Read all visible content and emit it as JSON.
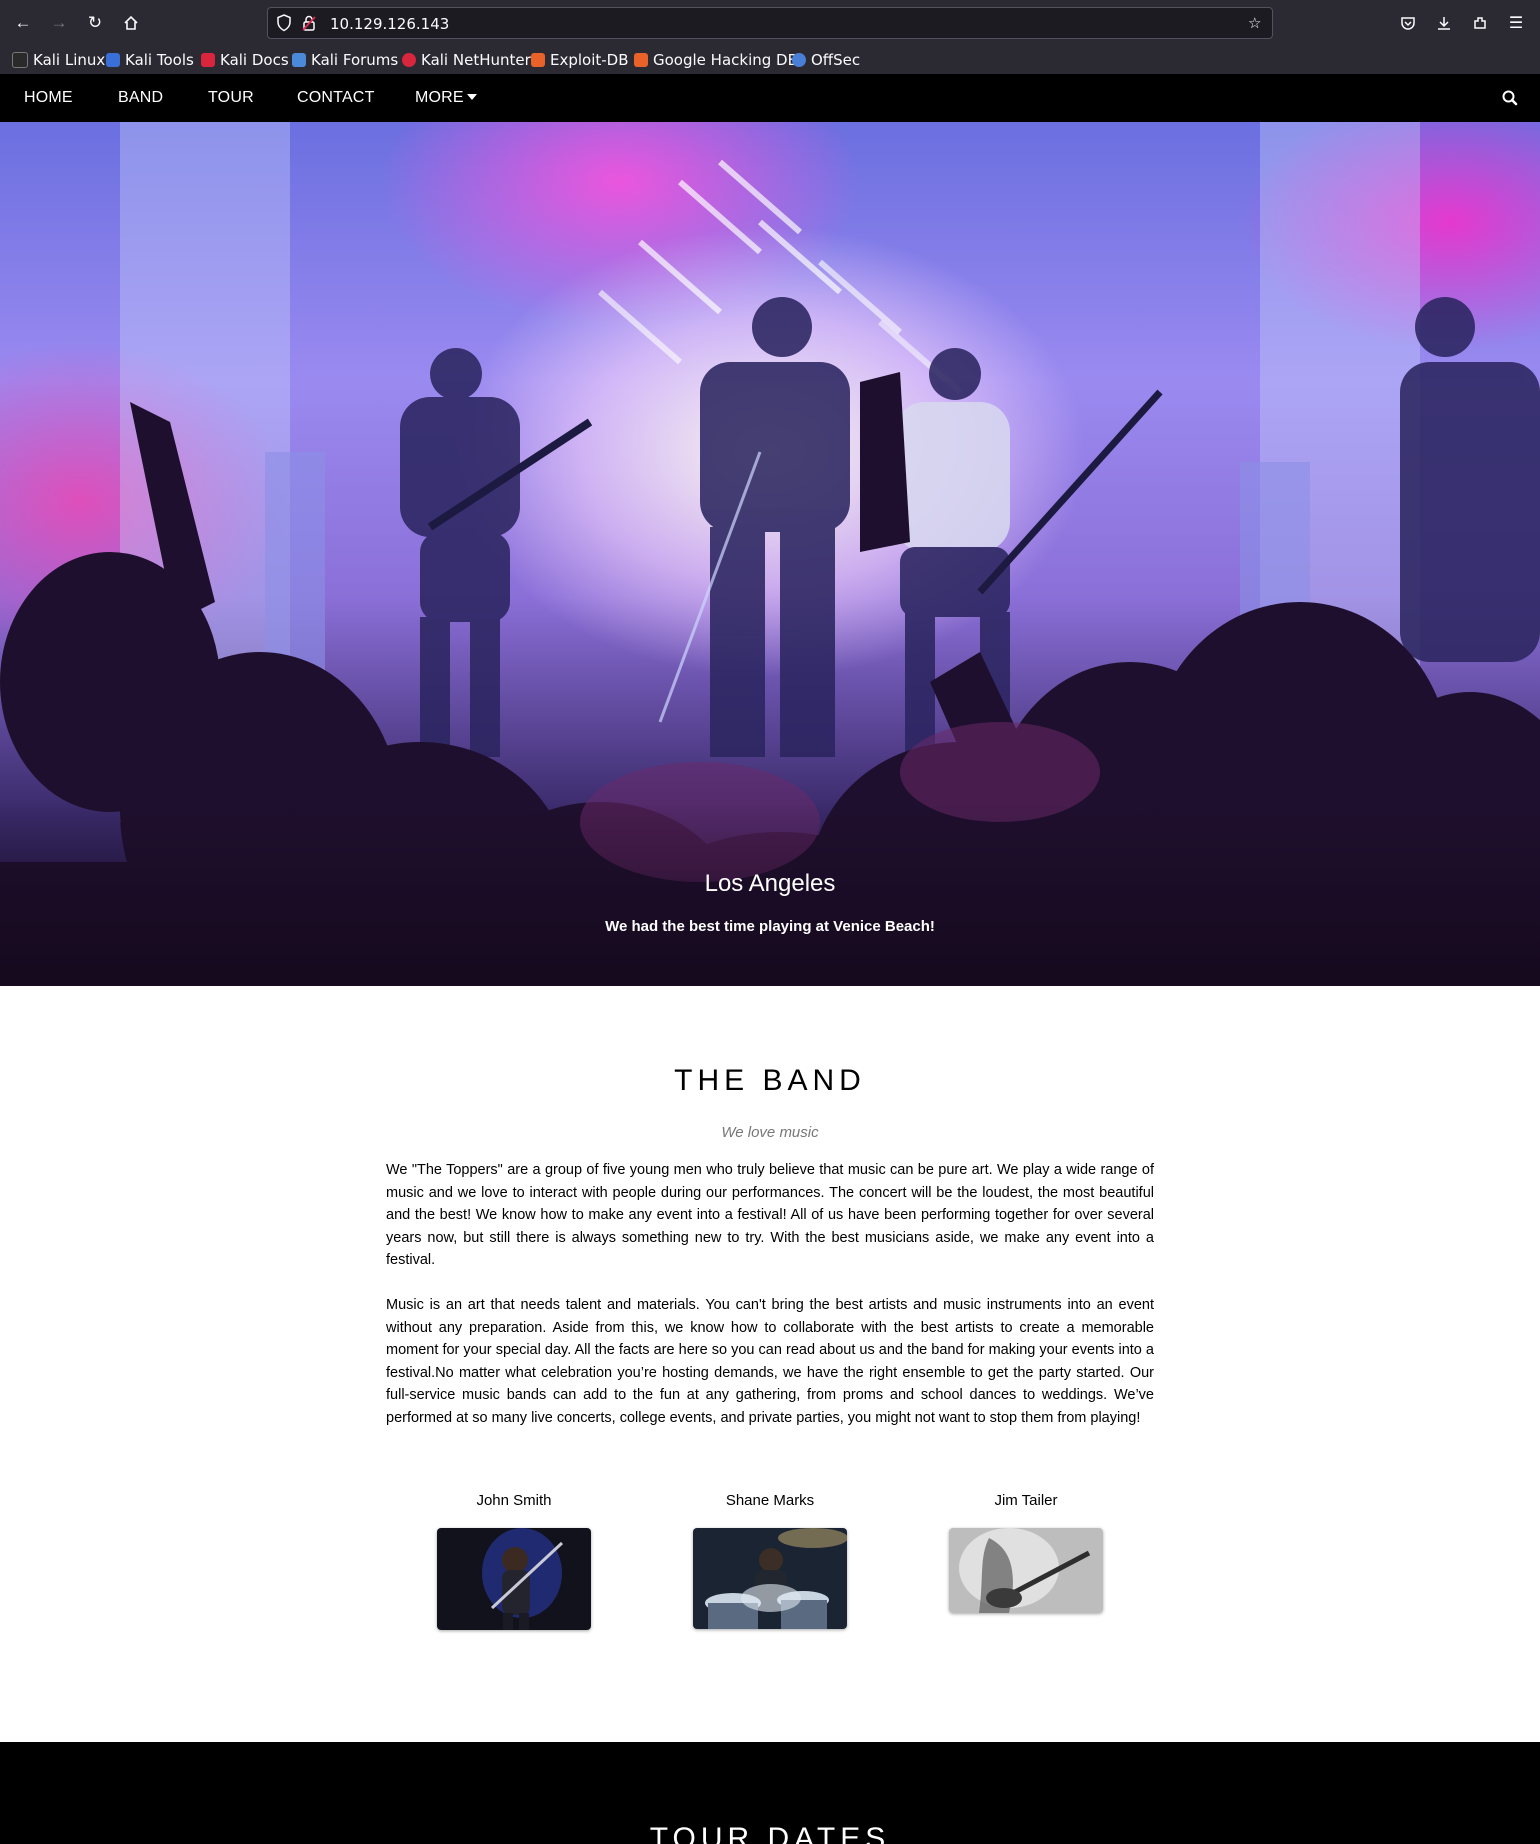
{
  "browser": {
    "url": "10.129.126.143",
    "bookmarks": [
      {
        "label": "Kali Linux",
        "color": "#2a2a2a"
      },
      {
        "label": "Kali Tools",
        "color": "#3b6fd8"
      },
      {
        "label": "Kali Docs",
        "color": "#d7263d"
      },
      {
        "label": "Kali Forums",
        "color": "#4a8ad8"
      },
      {
        "label": "Kali NetHunter",
        "color": "#d7263d"
      },
      {
        "label": "Exploit-DB",
        "color": "#e8622a"
      },
      {
        "label": "Google Hacking DB",
        "color": "#e8622a"
      },
      {
        "label": "OffSec",
        "color": "#4a7fd8"
      }
    ]
  },
  "nav": {
    "items": [
      "HOME",
      "BAND",
      "TOUR",
      "CONTACT"
    ],
    "more": "MORE"
  },
  "hero": {
    "title": "Los Angeles",
    "text": "We had the best time playing at Venice Beach!"
  },
  "band": {
    "title": "THE BAND",
    "tagline": "We love music",
    "paragraphs": [
      "We \"The Toppers\" are a group of five young men who truly believe that music can be pure art. We play a wide range of music and we love to interact with people during our performances. The concert will be the loudest, the most beautiful and the best! We know how to make any event into a festival! All of us have been performing together for over several years now, but still there is always something new to try. With the best musicians aside, we make any event into a festival.",
      "Music is an art that needs talent and materials. You can't bring the best artists and music instruments into an event without any preparation. Aside from this, we know how to collaborate with the best artists to create a memorable moment for your special day. All the facts are here so you can read about us and the band for making your events into a festival.No matter what celebration you’re hosting demands, we have the right ensemble to get the party started. Our full-service music bands can add to the fun at any gathering, from proms and school dances to weddings. We’ve performed at so many live concerts, college events, and private parties, you might not want to stop them from playing!"
    ],
    "members": [
      "John Smith",
      "Shane Marks",
      "Jim Tailer"
    ]
  },
  "tour": {
    "title": "TOUR DATES"
  }
}
